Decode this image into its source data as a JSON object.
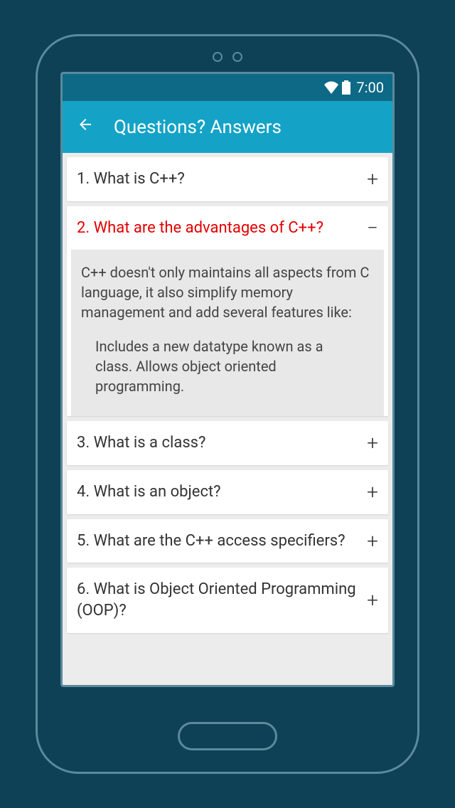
{
  "status": {
    "time": "7:00"
  },
  "appbar": {
    "title": "Questions? Answers"
  },
  "questions": [
    {
      "num": "1.",
      "text": "What is C++?",
      "expanded": false
    },
    {
      "num": "2.",
      "text": "What are the advantages of C++?",
      "expanded": true,
      "answer_p1": "C++ doesn't only maintains all aspects from C language, it also simplify memory management and add several features like:",
      "answer_p2": "Includes a new datatype known as a class. Allows object oriented programming."
    },
    {
      "num": "3.",
      "text": "What is a class?",
      "expanded": false
    },
    {
      "num": "4.",
      "text": "What is an object?",
      "expanded": false
    },
    {
      "num": "5.",
      "text": "What are the C++ access specifiers?",
      "expanded": false
    },
    {
      "num": "6.",
      "text": "What is Object Oriented Programming (OOP)?",
      "expanded": false
    }
  ]
}
